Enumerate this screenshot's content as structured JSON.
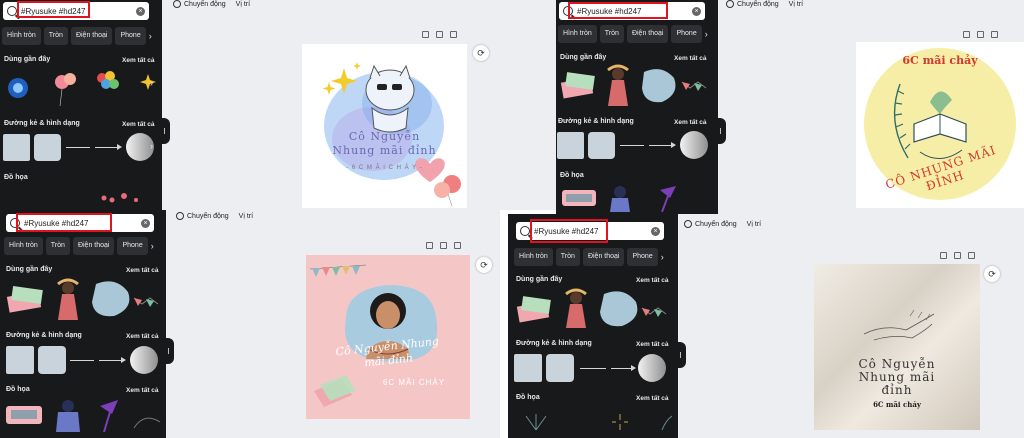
{
  "search": {
    "query": "#Ryusuke #hd247"
  },
  "chips": [
    "Hình tròn",
    "Tròn",
    "Điện thoại",
    "Phone"
  ],
  "sections": {
    "recent": "Dùng gần đây",
    "lines_shapes": "Đường kẻ & hình dạng",
    "graphics": "Đồ họa",
    "see_all": "Xem tất cả"
  },
  "toolbar": {
    "animate": "Chuyển động",
    "position": "Vị trí"
  },
  "designs": {
    "d1": {
      "title": "Cô Nguyễn\nNhung mãi đỉnh",
      "subtitle": "- 6 C M Ã I C H Á Y -"
    },
    "d2": {
      "top": "6C mãi chảy",
      "arc": "CÔ NHUNG MÃI ĐỈNH"
    },
    "d3": {
      "title": "Cô Nguyễn Nhung\nmãi đỉnh",
      "subtitle": "6C MÃI CHÁY"
    },
    "d4": {
      "title": "Cô Nguyễn\nNhung mãi\nđỉnh",
      "subtitle": "6C mãi cháy"
    }
  },
  "colors": {
    "sidebar": "#18191b",
    "chip": "#2e3034",
    "highlight": "#e0141e",
    "workspace": "#eceef1"
  }
}
